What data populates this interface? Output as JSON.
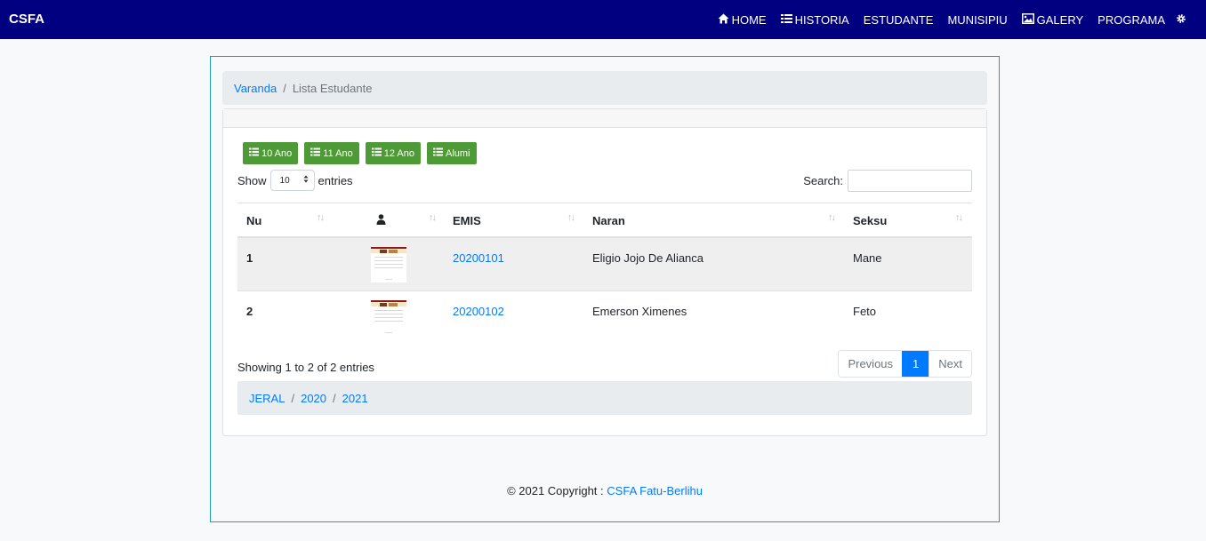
{
  "navbar": {
    "brand": "CSFA",
    "items": [
      {
        "label": "HOME",
        "icon": "home-icon"
      },
      {
        "label": "HISTORIA",
        "icon": "list-icon"
      },
      {
        "label": "ESTUDANTE"
      },
      {
        "label": "MUNISIPIU"
      },
      {
        "label": "GALERY",
        "icon": "image-icon"
      },
      {
        "label": "PROGRAMA"
      }
    ],
    "settings_icon": "gear-icon",
    "bg_color": "#000080"
  },
  "breadcrumb": {
    "home": "Varanda",
    "separator": "/",
    "current": "Lista Estudante"
  },
  "filter_buttons": [
    "10 Ano",
    "11 Ano",
    "12 Ano",
    "Alumi"
  ],
  "table_controls": {
    "show_label": "Show",
    "entries_value": "10",
    "entries_label": "entries",
    "search_label": "Search:",
    "search_value": ""
  },
  "table": {
    "columns": [
      "Nu",
      "",
      "EMIS",
      "Naran",
      "Seksu"
    ],
    "photo_column_icon": "user-icon",
    "rows": [
      {
        "nu": "1",
        "emis": "20200101",
        "naran": "Eligio Jojo De Alianca",
        "seksu": "Mane"
      },
      {
        "nu": "2",
        "emis": "20200102",
        "naran": "Emerson Ximenes",
        "seksu": "Feto"
      }
    ]
  },
  "pagination": {
    "info": "Showing 1 to 2 of 2 entries",
    "previous": "Previous",
    "current_page": "1",
    "next": "Next"
  },
  "year_breadcrumb": {
    "items": [
      "JERAL",
      "2020",
      "2021"
    ],
    "separator": "/"
  },
  "footer": {
    "text": "© 2021 Copyright :",
    "link": "CSFA Fatu-Berlihu"
  },
  "colors": {
    "link": "#007bff",
    "button_green": "#4e9a37",
    "frame_border": "#17a2b8"
  }
}
